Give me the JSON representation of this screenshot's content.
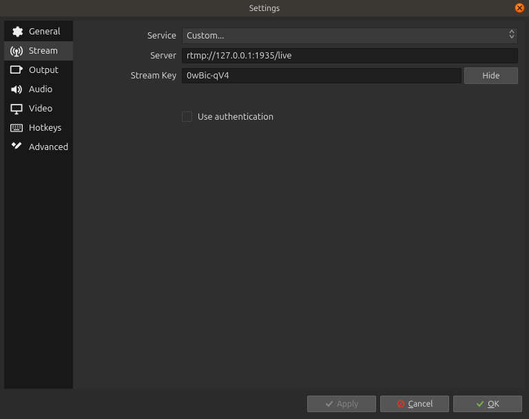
{
  "window": {
    "title": "Settings"
  },
  "sidebar": {
    "items": [
      {
        "label": "General",
        "icon": "gear-icon"
      },
      {
        "label": "Stream",
        "icon": "antenna-icon"
      },
      {
        "label": "Output",
        "icon": "output-icon"
      },
      {
        "label": "Audio",
        "icon": "speaker-icon"
      },
      {
        "label": "Video",
        "icon": "monitor-icon"
      },
      {
        "label": "Hotkeys",
        "icon": "keyboard-icon"
      },
      {
        "label": "Advanced",
        "icon": "tools-icon"
      }
    ],
    "selected_index": 1
  },
  "form": {
    "service_label": "Service",
    "service_value": "Custom...",
    "server_label": "Server",
    "server_value": "rtmp://127.0.0.1:1935/live",
    "key_label": "Stream Key",
    "key_value": "0wBic-qV4",
    "hide_button": "Hide",
    "use_auth_label": "Use authentication",
    "use_auth_checked": false
  },
  "footer": {
    "apply": "Apply",
    "cancel": "Cancel",
    "ok": "OK"
  }
}
